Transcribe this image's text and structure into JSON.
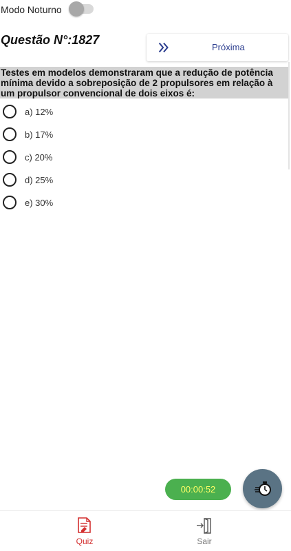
{
  "night_mode": {
    "label": "Modo Noturno",
    "enabled": false
  },
  "question": {
    "number_label": "Questão N°:1827",
    "text": "Testes em modelos demonstraram que a redução de potência mínima devido a sobreposição de 2 propulsores em relação à um propulsor convencional de dois eixos é:"
  },
  "next_button": {
    "label": "Próxima",
    "icon": "double-chevron-right-icon"
  },
  "options": [
    {
      "label": "a) 12%"
    },
    {
      "label": "b) 17%"
    },
    {
      "label": "c) 20%"
    },
    {
      "label": "d) 25%"
    },
    {
      "label": "e) 30%"
    }
  ],
  "timer": {
    "value": "00:00:52",
    "icon": "stopwatch-icon"
  },
  "bottom_nav": {
    "items": [
      {
        "label": "Quiz",
        "icon": "quiz-document-icon",
        "active": true
      },
      {
        "label": "Sair",
        "icon": "exit-door-icon",
        "active": false
      }
    ]
  },
  "colors": {
    "accent_red": "#d32f2f",
    "timer_green": "#4bb04f",
    "timer_text": "#ffff66",
    "fab_background": "#5a7384",
    "next_text": "#2c3e8f",
    "question_background": "#d2d2d2"
  }
}
